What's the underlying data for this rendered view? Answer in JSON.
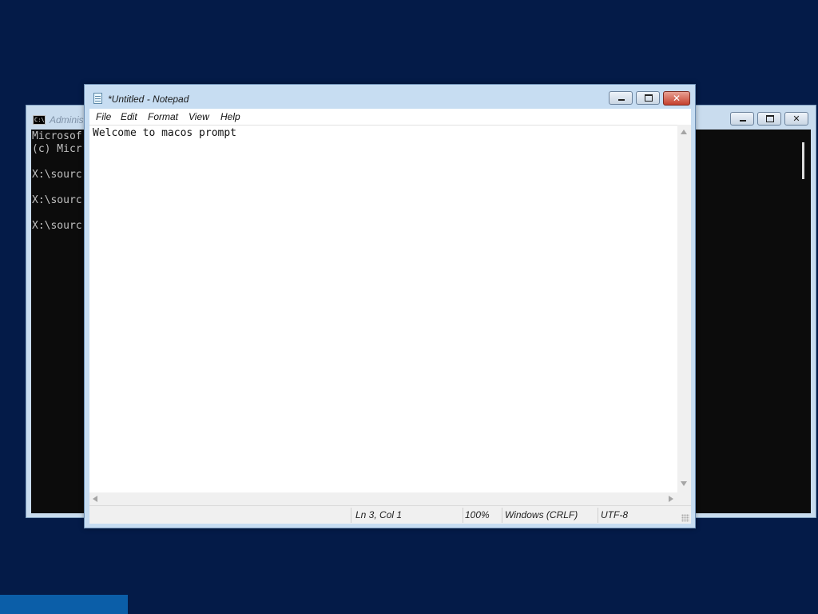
{
  "desktop": {
    "background_color": "#041b48"
  },
  "cmd_window": {
    "title": "Adminis",
    "icon_label": "C:\\",
    "icon": "command-prompt-icon",
    "lines": [
      "Microsof",
      "(c) Micr",
      "X:\\sourc",
      "X:\\sourc",
      "X:\\sourc"
    ],
    "buttons": [
      "minimize-icon",
      "maximize-icon",
      "close-icon"
    ]
  },
  "notepad": {
    "title": "*Untitled - Notepad",
    "icon": "notepad-icon",
    "menu": [
      "File",
      "Edit",
      "Format",
      "View",
      "Help"
    ],
    "content": "Welcome to macos prompt",
    "status": {
      "position": "Ln 3, Col 1",
      "zoom": "100%",
      "line_ending": "Windows (CRLF)",
      "encoding": "UTF-8"
    },
    "buttons": [
      "minimize-icon",
      "maximize-icon",
      "close-icon"
    ],
    "close_button_color": "#c5402d"
  },
  "taskbar": {
    "active_color": "#0b5ea8"
  }
}
